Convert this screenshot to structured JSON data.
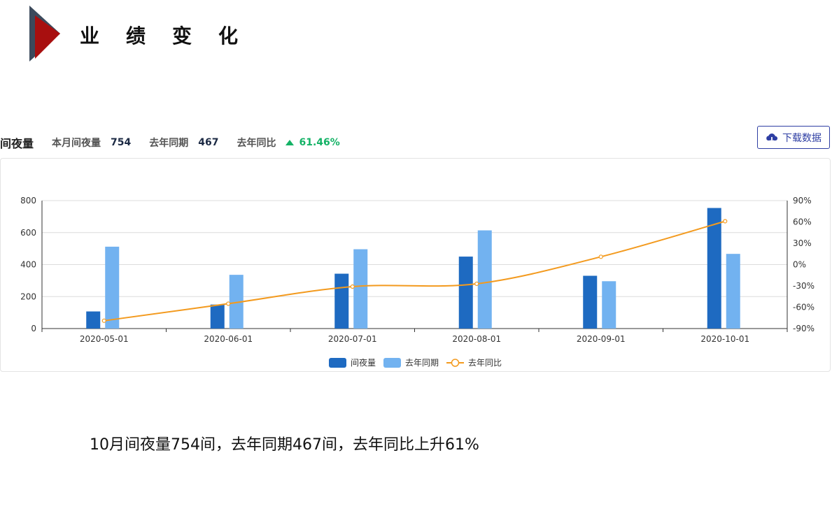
{
  "page": {
    "title": "业绩变化"
  },
  "stats": {
    "title": "间夜量",
    "current_label": "本月间夜量",
    "current_value": "754",
    "last_year_label": "去年同期",
    "last_year_value": "467",
    "yoy_label": "去年同比",
    "yoy_value": "61.46%"
  },
  "download": {
    "label": "下载数据",
    "icon": "cloud-download-icon"
  },
  "summary": "10月间夜量754间，去年同期467间，去年同比上升61%",
  "colors": {
    "series_current": "#1e6ac1",
    "series_last_year": "#72b2f0",
    "series_ratio": "#f39a1e",
    "yoy_up": "#14b266",
    "accent_dark": "#3c4a5c",
    "accent_red": "#a80f0f",
    "button": "#2e3ea3"
  },
  "chart_data": {
    "type": "bar",
    "categories": [
      "2020-05-01",
      "2020-06-01",
      "2020-07-01",
      "2020-08-01",
      "2020-09-01",
      "2020-10-01"
    ],
    "series": [
      {
        "name": "间夜量",
        "type": "bar",
        "axis": "left",
        "values": [
          107,
          150,
          343,
          450,
          330,
          754
        ]
      },
      {
        "name": "去年同期",
        "type": "bar",
        "axis": "left",
        "values": [
          512,
          336,
          496,
          614,
          296,
          467
        ]
      },
      {
        "name": "去年同比",
        "type": "line",
        "axis": "right",
        "values": [
          -79,
          -55,
          -31,
          -27,
          11,
          61
        ]
      }
    ],
    "y_left": {
      "ylim": [
        0,
        800
      ],
      "ticks": [
        "0",
        "200",
        "400",
        "600",
        "800"
      ]
    },
    "y_right": {
      "ylim": [
        -90,
        90
      ],
      "ticks": [
        "-90%",
        "-60%",
        "-30%",
        "0%",
        "30%",
        "60%",
        "90%"
      ]
    },
    "grid": true,
    "legend_position": "bottom"
  }
}
